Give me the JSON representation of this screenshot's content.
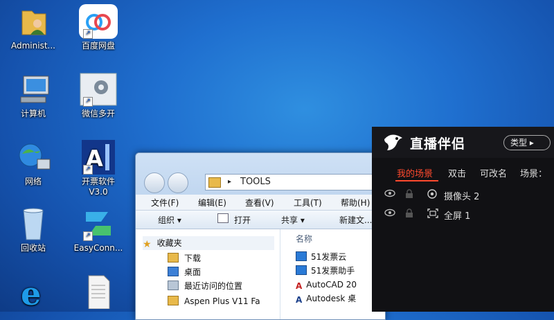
{
  "desktop": {
    "icons": [
      {
        "label": "Administ..."
      },
      {
        "label": "百度网盘"
      },
      {
        "label": "计算机"
      },
      {
        "label": "微信多开"
      },
      {
        "label": "网络"
      },
      {
        "label": "开票软件"
      },
      {
        "label": "V3.0"
      },
      {
        "label": "回收站"
      },
      {
        "label": "EasyConn..."
      }
    ]
  },
  "explorer": {
    "address": "TOOLS",
    "menu": [
      "文件(F)",
      "编辑(E)",
      "查看(V)",
      "工具(T)",
      "帮助(H)"
    ],
    "toolbar": [
      "组织 ▾",
      "打开",
      "共享 ▾",
      "新建文..."
    ],
    "nav_items": [
      "收藏夹",
      "下载",
      "桌面",
      "最近访问的位置",
      "Aspen Plus V11 Fa"
    ],
    "column_name": "名称",
    "files": [
      "51发票云",
      "51发票助手",
      "AutoCAD 20",
      "Autodesk 桌"
    ]
  },
  "live_panel": {
    "brand": "直播伴侣",
    "type_button": "类型 ▸",
    "tabs": [
      "我的场景",
      "双击",
      "可改名",
      "场景："
    ],
    "sources": [
      "摄像头 2",
      "全屏 1"
    ],
    "accent_color": "#ff4a2e"
  }
}
